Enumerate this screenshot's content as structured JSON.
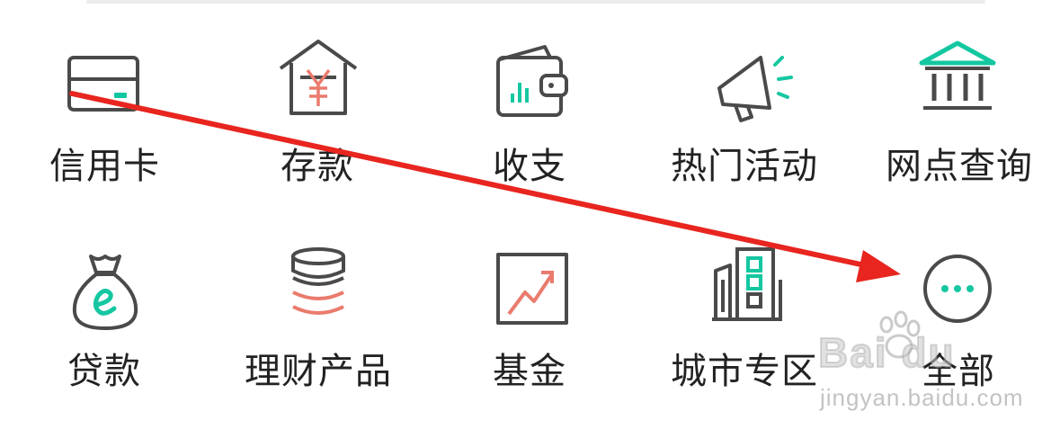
{
  "colors": {
    "icon_stroke": "#4a4a4a",
    "accent_teal": "#14c7a1",
    "accent_red": "#ea7b6d",
    "annotation_red": "#e8251f"
  },
  "grid": {
    "items": [
      {
        "label": "信用卡",
        "icon": "credit-card-icon"
      },
      {
        "label": "存款",
        "icon": "deposit-house-icon"
      },
      {
        "label": "收支",
        "icon": "wallet-chart-icon"
      },
      {
        "label": "热门活动",
        "icon": "megaphone-icon"
      },
      {
        "label": "网点查询",
        "icon": "bank-building-icon"
      },
      {
        "label": "贷款",
        "icon": "money-bag-icon"
      },
      {
        "label": "理财产品",
        "icon": "coin-stack-icon"
      },
      {
        "label": "基金",
        "icon": "trend-chart-icon"
      },
      {
        "label": "城市专区",
        "icon": "city-building-icon"
      },
      {
        "label": "全部",
        "icon": "more-dots-icon"
      }
    ]
  },
  "watermark": {
    "brand": "Bai du",
    "sub": "jingyan.baidu.com"
  }
}
